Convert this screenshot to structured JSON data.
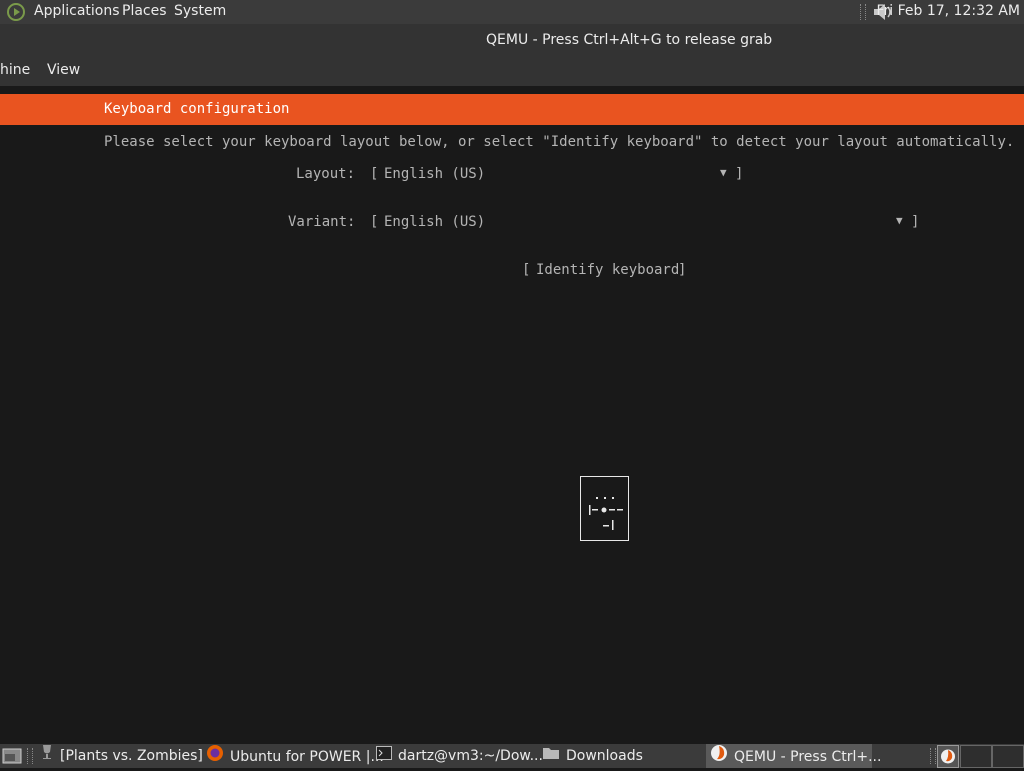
{
  "top_panel": {
    "menus": [
      "Applications",
      "Places",
      "System"
    ],
    "clock": "Fri Feb 17, 12:32 AM"
  },
  "window": {
    "title": "QEMU - Press Ctrl+Alt+G to release grab",
    "menus": [
      "hine",
      "View"
    ]
  },
  "installer": {
    "header": "Keyboard configuration",
    "intro": "Please select your keyboard layout below, or select \"Identify keyboard\" to detect your layout automatically.",
    "layout_label": "Layout:",
    "layout_value": "English (US)",
    "variant_label": "Variant:",
    "variant_value": "English (US)",
    "identify_button": "Identify keyboard"
  },
  "taskbar": {
    "items": [
      {
        "label": "[Plants vs. Zombies]",
        "icon": "wine-icon"
      },
      {
        "label": "Ubuntu for POWER |...",
        "icon": "firefox-icon"
      },
      {
        "label": "dartz@vm3:~/Dow...",
        "icon": "terminal-icon"
      },
      {
        "label": "Downloads",
        "icon": "folder-icon"
      },
      {
        "label": "QEMU - Press Ctrl+...",
        "icon": "qemu-icon",
        "active": true
      }
    ]
  },
  "colors": {
    "accent": "#e95420",
    "panel": "#3b3b3b",
    "guest_bg": "#191919"
  }
}
